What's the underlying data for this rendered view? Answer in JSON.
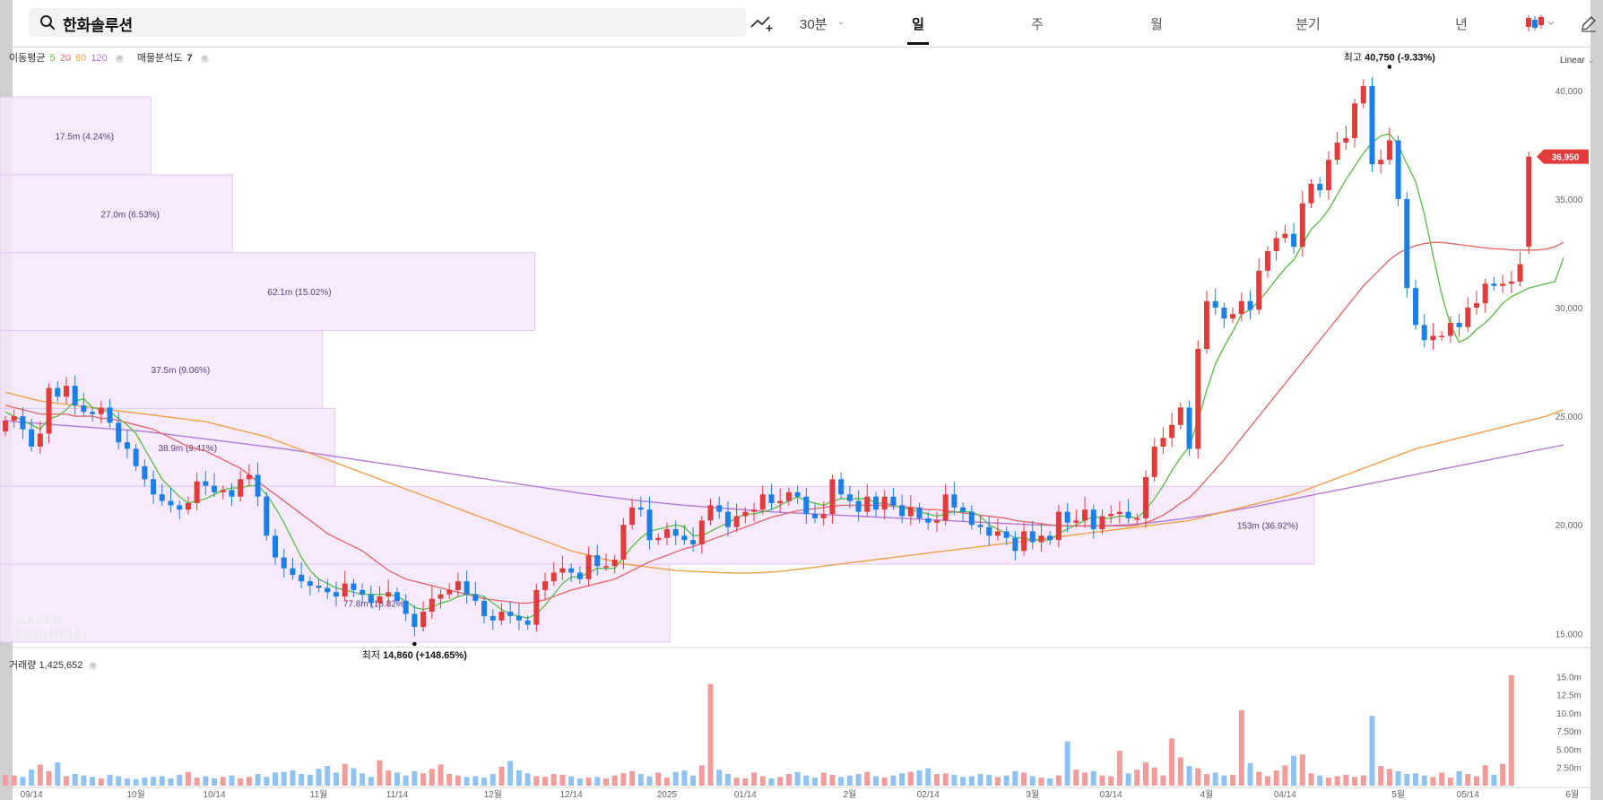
{
  "search": {
    "stock_name": "한화솔루션"
  },
  "toolbar": {
    "interval": "30분",
    "period_tabs": [
      "일",
      "주",
      "월",
      "분기",
      "년"
    ],
    "active_tab": "일"
  },
  "legend": {
    "ma_label": "이동평균",
    "ma_periods": [
      "5",
      "20",
      "60",
      "120"
    ],
    "vp_label": "매물분석도",
    "vp_value": "7",
    "colors": {
      "ma5": "#5fbf4a",
      "ma20": "#e86a6a",
      "ma60": "#f0a048",
      "ma120": "#b27ad8"
    }
  },
  "scale_mode": "Linear",
  "watermark": [
    "NAVER",
    "FINANCIAL"
  ],
  "volume_legend": {
    "label": "거래량",
    "value": "1,425,652"
  },
  "chart_data": [
    {
      "type": "candlestick",
      "title": "",
      "ylim": [
        14600,
        41600
      ],
      "y_ticks": [
        "40,000",
        "35,000",
        "30,000",
        "25,000",
        "20,000",
        "15,000"
      ],
      "x_ticks": [
        "09/14",
        "10월",
        "10/14",
        "11월",
        "11/14",
        "12월",
        "12/14",
        "2025",
        "01/14",
        "2월",
        "02/14",
        "3월",
        "03/14",
        "4월",
        "04/14",
        "5월",
        "05/14",
        "6월"
      ],
      "last_price": "36,950",
      "high_annotation": {
        "prefix": "최고",
        "value": "40,750",
        "change": "(-9.33%)"
      },
      "low_annotation": {
        "prefix": "최저",
        "value": "14,860",
        "change": "(+148.65%)"
      },
      "close": [
        24800,
        25000,
        24400,
        23600,
        24200,
        26300,
        25900,
        26400,
        25500,
        25200,
        25100,
        25400,
        24700,
        23800,
        23500,
        22700,
        22100,
        21400,
        21100,
        20900,
        20700,
        21000,
        22000,
        21800,
        21500,
        21600,
        21300,
        22100,
        22300,
        21300,
        19500,
        18500,
        18000,
        17700,
        17400,
        17200,
        17100,
        16900,
        16700,
        17300,
        17000,
        16800,
        16400,
        16700,
        16900,
        16500,
        15900,
        15300,
        16000,
        16600,
        16800,
        17000,
        17400,
        16800,
        16500,
        15800,
        15600,
        16000,
        15800,
        15600,
        15400,
        17000,
        17400,
        17800,
        18000,
        17800,
        17500,
        18600,
        18100,
        18100,
        18400,
        20000,
        20800,
        20700,
        19300,
        19400,
        19800,
        19500,
        19300,
        19100,
        20200,
        20900,
        20600,
        19900,
        20400,
        20600,
        20700,
        21400,
        21000,
        21100,
        21500,
        21300,
        20500,
        20300,
        20500,
        22100,
        21400,
        21100,
        20600,
        21300,
        20700,
        21300,
        20900,
        20400,
        20800,
        20300,
        20100,
        20200,
        21400,
        20800,
        20600,
        20000,
        19900,
        19500,
        19700,
        19400,
        18800,
        19700,
        19200,
        19500,
        19300,
        20600,
        20100,
        20200,
        20700,
        19800,
        20400,
        20500,
        20600,
        20300,
        20300,
        22200,
        23600,
        24000,
        24600,
        25400,
        23500,
        28100,
        30300,
        30000,
        29500,
        29700,
        30300,
        29900,
        31700,
        32600,
        33200,
        33400,
        32800,
        34800,
        35700,
        35400,
        36800,
        37600,
        37800,
        39400,
        40200,
        36600,
        36800,
        37700,
        35000,
        30900,
        29200,
        28500,
        28700,
        28700,
        29300,
        29100,
        30000,
        30200,
        31100,
        31000,
        31100,
        31200,
        32000,
        36950
      ],
      "ma5": [
        25200,
        25000,
        24800,
        24600,
        24400,
        24900,
        25000,
        25300,
        25700,
        25800,
        25400,
        25300,
        25200,
        24900,
        24600,
        24200,
        23500,
        22800,
        22100,
        21700,
        21300,
        21000,
        21100,
        21200,
        21400,
        21600,
        21700,
        21700,
        21800,
        21800,
        21400,
        20800,
        20100,
        19300,
        18500,
        17900,
        17500,
        17300,
        17100,
        17000,
        16900,
        16800,
        16800,
        16800,
        16800,
        16700,
        16500,
        16200,
        16100,
        16200,
        16400,
        16500,
        16700,
        16800,
        16800,
        16700,
        16400,
        16100,
        15900,
        15800,
        15700,
        15900,
        16300,
        16800,
        17300,
        17600,
        17600,
        17800,
        18000,
        18000,
        18000,
        18500,
        19000,
        19400,
        19700,
        19800,
        19900,
        20000,
        19900,
        19500,
        19500,
        19700,
        19900,
        20100,
        20300,
        20500,
        20500,
        20600,
        20700,
        20900,
        21100,
        21300,
        21100,
        21000,
        20900,
        21100,
        21200,
        21200,
        21200,
        21200,
        21000,
        21000,
        20900,
        20800,
        20700,
        20600,
        20500,
        20400,
        20500,
        20600,
        20600,
        20600,
        20400,
        20000,
        19800,
        19600,
        19400,
        19400,
        19300,
        19300,
        19300,
        19600,
        19800,
        20000,
        20200,
        20400,
        20300,
        20300,
        20400,
        20400,
        20300,
        20700,
        21200,
        21800,
        22500,
        23100,
        23600,
        24800,
        26200,
        27400,
        28200,
        28900,
        29700,
        29900,
        30300,
        30800,
        31300,
        31800,
        32200,
        32900,
        33600,
        34000,
        34500,
        35200,
        35900,
        36500,
        37100,
        37600,
        37900,
        38000,
        37500,
        36600,
        35800,
        34300,
        32400,
        30600,
        29200,
        28400,
        28600,
        29000,
        29300,
        29700,
        30200,
        30500,
        30700,
        30900,
        31000,
        31100,
        31200,
        32300
      ],
      "ma20": [
        25500,
        25400,
        25300,
        25200,
        25100,
        25100,
        25100,
        25100,
        25000,
        25000,
        25000,
        24900,
        24900,
        24800,
        24700,
        24600,
        24500,
        24400,
        24200,
        24000,
        23800,
        23600,
        23500,
        23400,
        23200,
        23000,
        22800,
        22600,
        22300,
        22000,
        21700,
        21400,
        21100,
        20800,
        20500,
        20200,
        19900,
        19600,
        19400,
        19200,
        19000,
        18800,
        18500,
        18200,
        17900,
        17700,
        17500,
        17400,
        17300,
        17200,
        17100,
        17000,
        16900,
        16800,
        16700,
        16600,
        16550,
        16500,
        16450,
        16400,
        16400,
        16450,
        16550,
        16700,
        16850,
        17000,
        17100,
        17200,
        17300,
        17400,
        17500,
        17700,
        17900,
        18100,
        18300,
        18450,
        18600,
        18750,
        18900,
        19000,
        19150,
        19300,
        19450,
        19600,
        19750,
        19900,
        20050,
        20200,
        20350,
        20450,
        20550,
        20650,
        20700,
        20750,
        20800,
        20850,
        20900,
        20900,
        20900,
        20900,
        20900,
        20900,
        20850,
        20850,
        20800,
        20750,
        20700,
        20700,
        20650,
        20600,
        20550,
        20500,
        20450,
        20400,
        20350,
        20300,
        20200,
        20150,
        20100,
        20050,
        20000,
        19950,
        19950,
        19950,
        19950,
        19950,
        19950,
        19950,
        19950,
        19950,
        20000,
        20100,
        20250,
        20450,
        20700,
        21000,
        21250,
        21650,
        22100,
        22550,
        23000,
        23500,
        24000,
        24500,
        25000,
        25500,
        26000,
        26500,
        27000,
        27500,
        28000,
        28500,
        29000,
        29500,
        30000,
        30500,
        31000,
        31400,
        31800,
        32200,
        32500,
        32700,
        32850,
        32950,
        33000,
        33000,
        32950,
        32900,
        32850,
        32800,
        32750,
        32700,
        32700,
        32650,
        32650,
        32650,
        32650,
        32700,
        32800,
        33000
      ],
      "ma60": [
        26100,
        26000,
        25900,
        25800,
        25700,
        25650,
        25600,
        25550,
        25500,
        25450,
        25400,
        25350,
        25300,
        25250,
        25200,
        25150,
        25100,
        25050,
        25000,
        24950,
        24900,
        24850,
        24800,
        24750,
        24650,
        24550,
        24450,
        24350,
        24250,
        24150,
        24050,
        23900,
        23750,
        23600,
        23450,
        23300,
        23150,
        23000,
        22850,
        22700,
        22550,
        22400,
        22250,
        22100,
        21950,
        21800,
        21650,
        21500,
        21350,
        21200,
        21050,
        20900,
        20750,
        20600,
        20450,
        20300,
        20150,
        20000,
        19850,
        19700,
        19550,
        19400,
        19250,
        19100,
        18950,
        18800,
        18700,
        18600,
        18500,
        18400,
        18300,
        18200,
        18150,
        18100,
        18050,
        18000,
        17950,
        17900,
        17880,
        17860,
        17840,
        17820,
        17800,
        17790,
        17780,
        17780,
        17790,
        17800,
        17830,
        17860,
        17900,
        17950,
        18000,
        18050,
        18100,
        18150,
        18200,
        18250,
        18300,
        18350,
        18400,
        18450,
        18500,
        18550,
        18600,
        18650,
        18700,
        18750,
        18800,
        18850,
        18900,
        18950,
        19000,
        19050,
        19100,
        19150,
        19200,
        19250,
        19300,
        19350,
        19400,
        19450,
        19500,
        19550,
        19600,
        19650,
        19700,
        19750,
        19800,
        19850,
        19900,
        19950,
        20000,
        20050,
        20100,
        20150,
        20200,
        20300,
        20400,
        20500,
        20600,
        20700,
        20800,
        20900,
        21000,
        21100,
        21200,
        21300,
        21400,
        21550,
        21700,
        21850,
        22000,
        22150,
        22300,
        22450,
        22600,
        22750,
        22900,
        23050,
        23200,
        23350,
        23500,
        23600,
        23700,
        23800,
        23900,
        24000,
        24100,
        24200,
        24300,
        24400,
        24500,
        24600,
        24700,
        24800,
        24900,
        25000,
        25150,
        25300
      ],
      "ma120": [
        24800,
        24750,
        24720,
        24690,
        24660,
        24630,
        24600,
        24570,
        24540,
        24510,
        24480,
        24450,
        24420,
        24390,
        24360,
        24330,
        24300,
        24250,
        24200,
        24150,
        24100,
        24050,
        24000,
        23950,
        23900,
        23850,
        23800,
        23750,
        23700,
        23650,
        23600,
        23550,
        23500,
        23440,
        23380,
        23320,
        23260,
        23200,
        23140,
        23080,
        23020,
        22960,
        22900,
        22840,
        22780,
        22720,
        22660,
        22600,
        22540,
        22480,
        22420,
        22360,
        22300,
        22240,
        22180,
        22120,
        22060,
        22000,
        21940,
        21880,
        21820,
        21760,
        21700,
        21640,
        21580,
        21520,
        21460,
        21400,
        21350,
        21300,
        21250,
        21200,
        21150,
        21100,
        21060,
        21020,
        20980,
        20940,
        20900,
        20870,
        20840,
        20810,
        20780,
        20750,
        20720,
        20690,
        20660,
        20630,
        20600,
        20580,
        20560,
        20540,
        20520,
        20500,
        20480,
        20460,
        20440,
        20420,
        20400,
        20380,
        20360,
        20340,
        20320,
        20300,
        20280,
        20260,
        20240,
        20220,
        20200,
        20180,
        20160,
        20140,
        20120,
        20100,
        20080,
        20060,
        20040,
        20020,
        20000,
        19990,
        19980,
        19970,
        19960,
        19950,
        19950,
        19950,
        19960,
        19970,
        19990,
        20010,
        20040,
        20080,
        20120,
        20170,
        20220,
        20270,
        20330,
        20390,
        20450,
        20520,
        20590,
        20660,
        20730,
        20800,
        20880,
        20960,
        21040,
        21120,
        21200,
        21280,
        21360,
        21440,
        21520,
        21600,
        21680,
        21760,
        21840,
        21920,
        22000,
        22080,
        22160,
        22240,
        22320,
        22400,
        22480,
        22560,
        22640,
        22720,
        22800,
        22880,
        22960,
        23040,
        23120,
        23200,
        23280,
        23360,
        23440,
        23520,
        23600,
        23680
      ],
      "volume_profile": [
        {
          "label": "17.5m (4.24%)",
          "share": 0.0424
        },
        {
          "label": "27.0m (6.53%)",
          "share": 0.0653
        },
        {
          "label": "62.1m (15.02%)",
          "share": 0.1502
        },
        {
          "label": "37.5m (9.06%)",
          "share": 0.0906
        },
        {
          "label": "38.9m (9.41%)",
          "share": 0.0941
        },
        {
          "label": "153m (36.92%)",
          "share": 0.3692
        },
        {
          "label": "77.8m (18.82%)",
          "share": 0.1882
        }
      ],
      "volume_profile_max_share": 0.3692
    },
    {
      "type": "bar",
      "title": "",
      "y_ticks": [
        "15.0m",
        "12.5m",
        "10.0m",
        "7.50m",
        "5.00m",
        "2.50m"
      ],
      "ylim_millions": [
        0,
        15.8
      ],
      "volume_millions": [
        1.5,
        1.4,
        1.2,
        2.2,
        2.9,
        2.0,
        3.2,
        1.3,
        1.6,
        1.4,
        1.2,
        1.0,
        1.5,
        1.3,
        1.0,
        0.9,
        1.1,
        1.2,
        1.3,
        1.0,
        1.5,
        1.9,
        1.1,
        1.3,
        1.0,
        1.2,
        1.4,
        1.0,
        1.2,
        1.6,
        1.2,
        1.8,
        1.9,
        2.1,
        1.6,
        1.5,
        2.3,
        2.7,
        1.8,
        3.0,
        2.4,
        1.7,
        1.2,
        3.5,
        2.1,
        1.8,
        1.4,
        2.0,
        1.7,
        2.3,
        2.9,
        1.6,
        1.4,
        1.2,
        1.3,
        1.1,
        1.6,
        2.6,
        3.4,
        2.1,
        1.7,
        1.3,
        1.2,
        1.6,
        1.5,
        1.3,
        1.0,
        1.1,
        1.2,
        1.0,
        1.4,
        1.7,
        2.0,
        1.6,
        1.3,
        1.8,
        1.1,
        1.9,
        2.1,
        1.4,
        2.8,
        14.0,
        2.2,
        1.6,
        1.1,
        1.0,
        1.8,
        1.3,
        1.0,
        1.2,
        1.6,
        1.9,
        1.4,
        1.1,
        1.8,
        1.5,
        1.2,
        1.4,
        1.6,
        1.9,
        1.3,
        1.1,
        1.4,
        1.7,
        1.9,
        2.1,
        2.4,
        1.6,
        1.7,
        1.5,
        1.2,
        1.3,
        1.6,
        1.5,
        1.2,
        1.4,
        2.0,
        1.8,
        1.3,
        1.1,
        1.0,
        1.4,
        6.1,
        2.2,
        1.8,
        2.0,
        1.4,
        1.3,
        4.8,
        1.7,
        2.2,
        3.2,
        2.5,
        1.4,
        6.5,
        3.9,
        2.7,
        2.4,
        1.6,
        1.8,
        1.4,
        1.5,
        10.4,
        3.1,
        1.9,
        1.3,
        2.1,
        2.8,
        4.1,
        4.3,
        1.7,
        1.4,
        1.1,
        1.3,
        1.5,
        1.2,
        1.4,
        9.6,
        2.7,
        2.3,
        2.0,
        1.6,
        1.7,
        1.4,
        1.2,
        1.8,
        1.1,
        2.0,
        1.6,
        1.3,
        2.8,
        1.5,
        3.0
      ],
      "last_volume_millions": 15.2
    }
  ]
}
